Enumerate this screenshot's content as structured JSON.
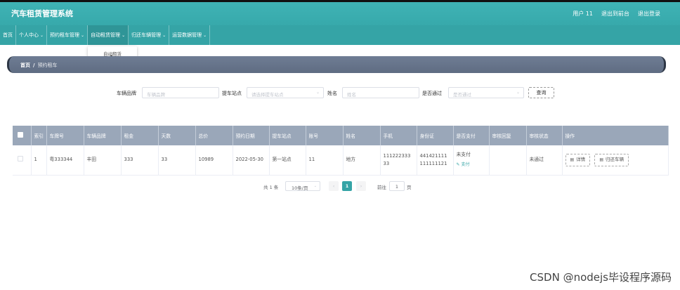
{
  "header": {
    "title": "汽车租赁管理系统",
    "user": "用户 11",
    "back_to_console": "退出到前台",
    "logout": "退出登录"
  },
  "nav": {
    "items": [
      {
        "label": "首页",
        "dropdown": false
      },
      {
        "label": "个人中心",
        "dropdown": true
      },
      {
        "label": "预约租车管理",
        "dropdown": true
      },
      {
        "label": "自动租赁管理",
        "dropdown": true
      },
      {
        "label": "归还车辆管理",
        "dropdown": true
      },
      {
        "label": "运营数据管理",
        "dropdown": true
      }
    ],
    "open_submenu": "自动租赁"
  },
  "breadcrumb": {
    "home": "首页",
    "separator": "/",
    "current": "预约租车"
  },
  "search": {
    "brand_label": "车辆品牌",
    "brand_placeholder": "车辆品牌",
    "station_label": "提车站点",
    "station_placeholder": "请选择提车站点",
    "name_label": "姓名",
    "name_placeholder": "姓名",
    "approved_label": "是否通过",
    "approved_placeholder": "是否通过",
    "query_button": "查询"
  },
  "table": {
    "columns": [
      "索引",
      "车牌号",
      "车辆品牌",
      "租金",
      "天数",
      "总价",
      "预约日期",
      "提车站点",
      "账号",
      "姓名",
      "手机",
      "身份证",
      "是否支付",
      "审核回复",
      "审核状态",
      "操作"
    ],
    "rows": [
      {
        "index": "1",
        "plate": "粤333344",
        "brand": "丰田",
        "rent": "333",
        "days": "33",
        "total": "10989",
        "date": "2022-05-30",
        "station": "第一站点",
        "account": "11",
        "name": "地方",
        "phone_line1": "111222333",
        "phone_line2": "33",
        "id_line1": "441421111",
        "id_line2": "111111121",
        "paid_status": "未支付",
        "pay_link": "支付",
        "reply": "",
        "review_status": "未通过",
        "detail_button": "详情",
        "return_button": "归还车辆"
      }
    ]
  },
  "pagination": {
    "total": "共 1 条",
    "page_size": "10条/页",
    "current_page": "1",
    "goto_label": "前往",
    "goto_value": "1",
    "page_suffix": "页"
  },
  "watermark": "CSDN @nodejs毕设程序源码",
  "colors": {
    "primary": "#35a4a6",
    "header_bg": "#3fb3b5",
    "breadcrumb_bg": "#6f7d94",
    "table_header_bg": "#9aa7b9"
  }
}
